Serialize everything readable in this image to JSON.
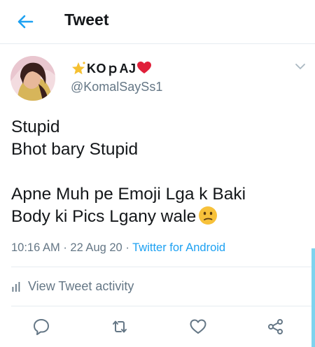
{
  "header": {
    "title": "Tweet",
    "accent_color": "#1da1f2"
  },
  "tweet": {
    "author": {
      "display_name": "KOｐAJ",
      "handle": "@KomalSaySs1"
    },
    "lines": [
      "Stupid",
      "Bhot bary Stupid",
      "",
      "Apne Muh pe Emoji Lga k Baki",
      "Body ki Pics Lgany wale"
    ],
    "time": "10:16 AM",
    "date": "22 Aug 20",
    "source": "Twitter for Android",
    "separator": "·"
  },
  "activity": {
    "label": "View Tweet activity"
  },
  "actions": {
    "icons": [
      "reply-icon",
      "retweet-icon",
      "like-icon",
      "share-icon"
    ]
  }
}
